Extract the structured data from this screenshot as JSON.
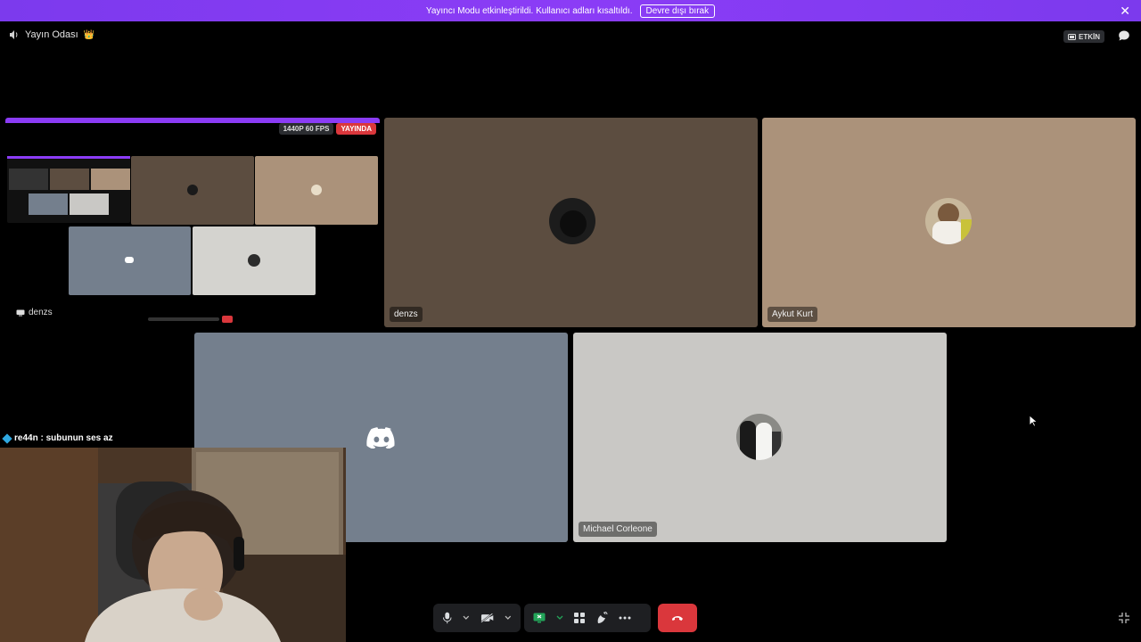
{
  "banner": {
    "text": "Yayıncı Modu etkinleştirildi. Kullanıcı adları kısaltıldı.",
    "button_label": "Devre dışı bırak",
    "close_glyph": "✕"
  },
  "header": {
    "channel_name": "Yayın Odası",
    "crown_emoji": "👑",
    "live_badge": "ETKİN"
  },
  "stream_tile": {
    "quality_badge": "1440P 60 FPS",
    "live_badge": "YAYINDA",
    "streamer_name": "denzs"
  },
  "participants": [
    {
      "name": "denzs",
      "bg": "#5c4d40"
    },
    {
      "name": "Aykut Kurt",
      "bg": "#ab927a"
    },
    {
      "name": "",
      "bg": "#747f8d"
    },
    {
      "name": "Michael Corleone",
      "bg": "#c9c8c5"
    }
  ],
  "chat_message": {
    "user": "re44n",
    "text": "re44n : subunun ses az"
  },
  "colors": {
    "banner": "#8b3cf6",
    "hangup": "#da373c",
    "discord_blurple": "#ffffff"
  },
  "icons": [
    "speaker-icon",
    "live-icon",
    "chat-icon",
    "mic-icon",
    "camera-off-icon",
    "screen-share-icon",
    "activities-icon",
    "soundboard-icon",
    "more-icon",
    "hangup-icon",
    "collapse-icon",
    "discord-logo-icon"
  ]
}
